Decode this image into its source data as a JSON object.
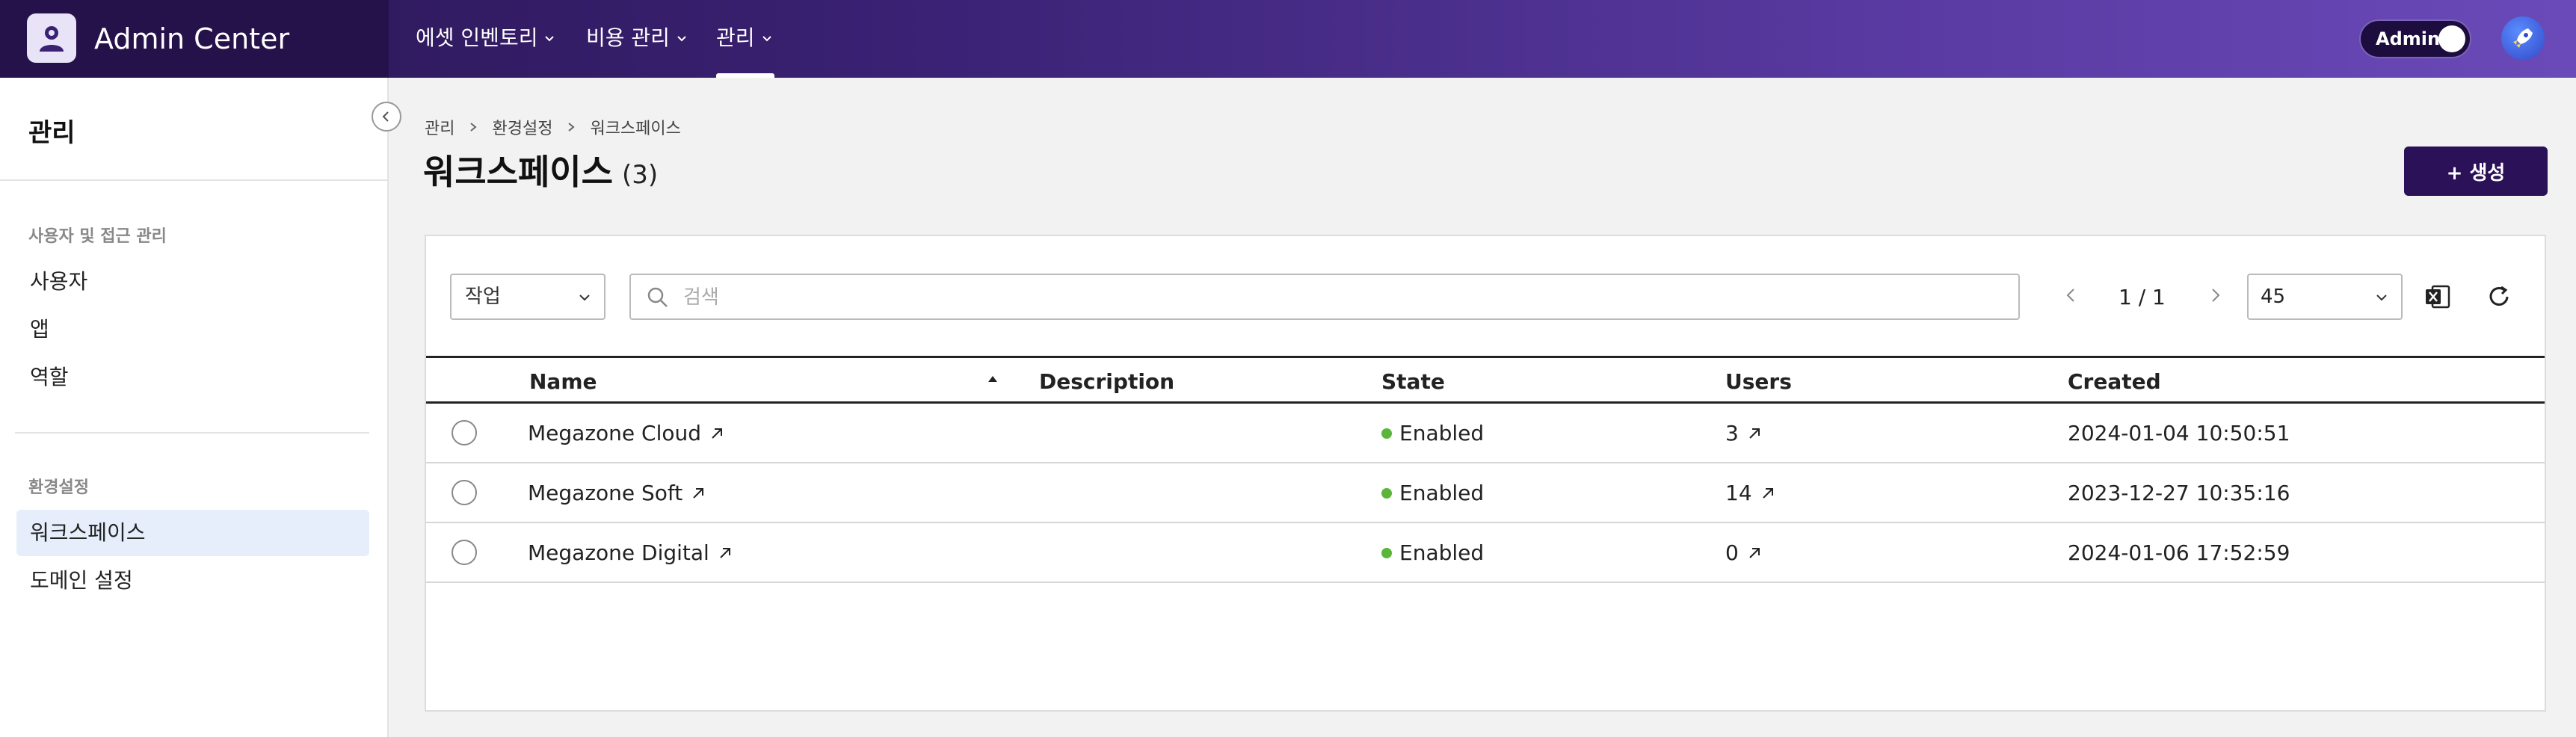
{
  "app": {
    "title": "Admin Center"
  },
  "nav": [
    {
      "label": "에셋 인벤토리"
    },
    {
      "label": "비용 관리"
    },
    {
      "label": "관리"
    }
  ],
  "header": {
    "admin_toggle_label": "Admin"
  },
  "sidebar": {
    "title": "관리",
    "sections": [
      {
        "title": "사용자 및 접근 관리",
        "items": [
          "사용자",
          "앱",
          "역할"
        ]
      },
      {
        "title": "환경설정",
        "items": [
          "워크스페이스",
          "도메인 설정"
        ]
      }
    ],
    "active_item": "워크스페이스"
  },
  "breadcrumb": [
    "관리",
    "환경설정",
    "워크스페이스"
  ],
  "page": {
    "title": "워크스페이스",
    "count": "(3)",
    "create_label": "+ 생성"
  },
  "toolbar": {
    "action_select": "작업",
    "search_placeholder": "검색",
    "pagination": "1 / 1",
    "page_size": "45"
  },
  "table": {
    "columns": [
      "Name",
      "Description",
      "State",
      "Users",
      "Created"
    ],
    "rows": [
      {
        "name": "Megazone Cloud",
        "description": "",
        "state": "Enabled",
        "users": "3",
        "created": "2024-01-04 10:50:51"
      },
      {
        "name": "Megazone Soft",
        "description": "",
        "state": "Enabled",
        "users": "14",
        "created": "2023-12-27 10:35:16"
      },
      {
        "name": "Megazone Digital",
        "description": "",
        "state": "Enabled",
        "users": "0",
        "created": "2024-01-06 17:52:59"
      }
    ]
  },
  "colors": {
    "brand_dark": "#25124a",
    "accent": "#2b1158",
    "status_enabled": "#5bb53b",
    "active_bg": "#e6eefb"
  }
}
